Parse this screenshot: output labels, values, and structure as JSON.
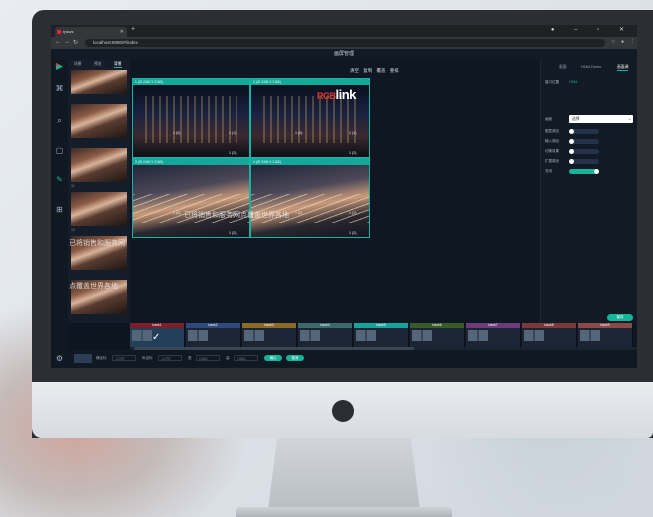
{
  "browser": {
    "tab_title": "rpsws",
    "url": "localhost:8080/#/index"
  },
  "app": {
    "title": "画屏管理"
  },
  "thumbs": {
    "tabs": [
      "场景",
      "预览",
      "背景"
    ],
    "captions": [
      "",
      "",
      "11",
      "12",
      "",
      "",
      "",
      ""
    ]
  },
  "preview": {
    "toolbar": [
      "清空",
      "复制",
      "覆盖",
      "重排"
    ],
    "windows": [
      {
        "header": "1  (ID 2400 X 2160)",
        "labels": [
          "1 (0)",
          "1 (1)",
          "1 (2)"
        ]
      },
      {
        "header": "2  (ID 2400 X 2160)",
        "labels": [
          "1 (0)",
          "1 (1)",
          "1 (2)"
        ]
      },
      {
        "header": "3  (ID 2400 X 2160)",
        "labels": [
          "1 (0)",
          "1 (1)",
          "1 (2)"
        ]
      },
      {
        "header": "4  (ID 2400 X 2160)",
        "labels": [
          "1 (0)",
          "1 (1)",
          "1 (2)"
        ]
      }
    ],
    "brand_rgb": "RGB",
    "brand_link": "link",
    "scroll_text": "已将销售和服务网点覆盖世界各地",
    "thumb_overlay_1": "已将销售和服务网",
    "thumb_overlay_2": "点覆盖世界各地"
  },
  "right_panel": {
    "tabs": [
      "画面",
      "H264 Demo",
      "画面调"
    ],
    "rows": [
      {
        "label": "窗口位置",
        "value": "H264"
      },
      {
        "label": "画面",
        "value": "选择"
      },
      {
        "label": "图层调出"
      },
      {
        "label": "输入调出"
      },
      {
        "label": "切换效果"
      },
      {
        "label": "扩展调出"
      },
      {
        "label": "关闭"
      }
    ],
    "select_value": "选择",
    "apply_label": "保存"
  },
  "scenes": [
    {
      "name": "bank1",
      "color": "#7a1f2b"
    },
    {
      "name": "bank2",
      "color": "#2f4a7a"
    },
    {
      "name": "bank3",
      "color": "#8a6a2a"
    },
    {
      "name": "bank4",
      "color": "#3a6a6a"
    },
    {
      "name": "bank5",
      "color": "#17a39a"
    },
    {
      "name": "bank6",
      "color": "#3a5a2a"
    },
    {
      "name": "bank7",
      "color": "#6a3a7a"
    },
    {
      "name": "bank8",
      "color": "#7a3a3a"
    },
    {
      "name": "bank9",
      "color": "#8a4a4a"
    }
  ],
  "bottom_bar": {
    "fields": [
      "横坐标",
      "纵坐标",
      "宽",
      "高"
    ],
    "values": [
      "-12797",
      "-12797",
      "10081",
      "10081"
    ],
    "buttons": [
      "确认",
      "取消"
    ]
  },
  "colors": {
    "accent": "#17b49c",
    "window_border": "#14b3a4",
    "brand_red": "#e63a2e"
  }
}
